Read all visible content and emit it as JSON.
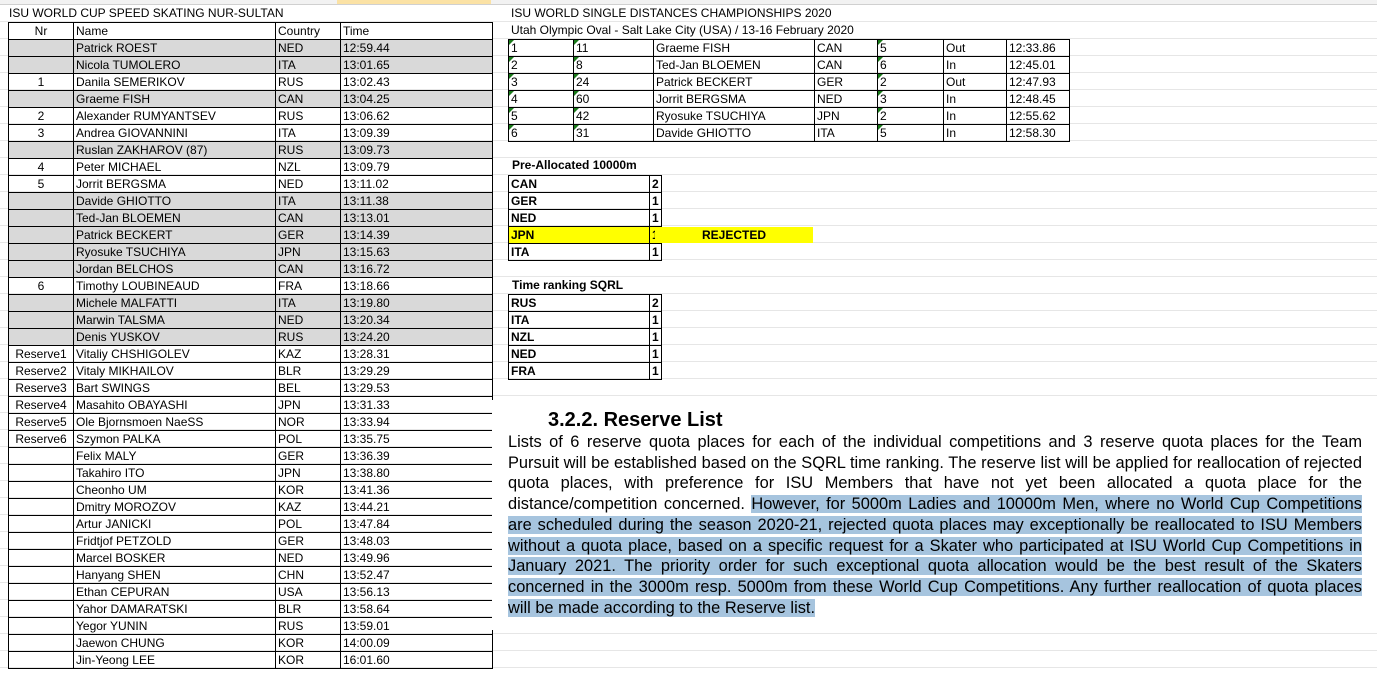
{
  "left_sheet": {
    "title": "ISU WORLD CUP SPEED SKATING NUR-SULTAN",
    "headers": {
      "nr": "Nr",
      "name": "Name",
      "country": "Country",
      "time": "Time"
    },
    "rows": [
      {
        "nr": "",
        "name": "Patrick ROEST",
        "country": "NED",
        "time": "12:59.44",
        "gray": true
      },
      {
        "nr": "",
        "name": "Nicola TUMOLERO",
        "country": "ITA",
        "time": "13:01.65",
        "gray": true
      },
      {
        "nr": "1",
        "name": "Danila SEMERIKOV",
        "country": "RUS",
        "time": "13:02.43",
        "gray": false
      },
      {
        "nr": "",
        "name": "Graeme FISH",
        "country": "CAN",
        "time": "13:04.25",
        "gray": true
      },
      {
        "nr": "2",
        "name": "Alexander RUMYANTSEV",
        "country": "RUS",
        "time": "13:06.62",
        "gray": false
      },
      {
        "nr": "3",
        "name": "Andrea GIOVANNINI",
        "country": "ITA",
        "time": "13:09.39",
        "gray": false
      },
      {
        "nr": "",
        "name": "Ruslan ZAKHAROV (87)",
        "country": "RUS",
        "time": "13:09.73",
        "gray": true
      },
      {
        "nr": "4",
        "name": "Peter MICHAEL",
        "country": "NZL",
        "time": "13:09.79",
        "gray": false
      },
      {
        "nr": "5",
        "name": "Jorrit BERGSMA",
        "country": "NED",
        "time": "13:11.02",
        "gray": false
      },
      {
        "nr": "",
        "name": "Davide GHIOTTO",
        "country": "ITA",
        "time": "13:11.38",
        "gray": true
      },
      {
        "nr": "",
        "name": "Ted-Jan BLOEMEN",
        "country": "CAN",
        "time": "13:13.01",
        "gray": true
      },
      {
        "nr": "",
        "name": "Patrick BECKERT",
        "country": "GER",
        "time": "13:14.39",
        "gray": true
      },
      {
        "nr": "",
        "name": "Ryosuke TSUCHIYA",
        "country": "JPN",
        "time": "13:15.63",
        "gray": true
      },
      {
        "nr": "",
        "name": "Jordan BELCHOS",
        "country": "CAN",
        "time": "13:16.72",
        "gray": true
      },
      {
        "nr": "6",
        "name": "Timothy LOUBINEAUD",
        "country": "FRA",
        "time": "13:18.66",
        "gray": false
      },
      {
        "nr": "",
        "name": "Michele MALFATTI",
        "country": "ITA",
        "time": "13:19.80",
        "gray": true
      },
      {
        "nr": "",
        "name": "Marwin TALSMA",
        "country": "NED",
        "time": "13:20.34",
        "gray": true
      },
      {
        "nr": "",
        "name": "Denis YUSKOV",
        "country": "RUS",
        "time": "13:24.20",
        "gray": true
      },
      {
        "nr": "Reserve1",
        "name": "Vitaliy CHSHIGOLEV",
        "country": "KAZ",
        "time": "13:28.31",
        "gray": false
      },
      {
        "nr": "Reserve2",
        "name": "Vitaly MIKHAILOV",
        "country": "BLR",
        "time": "13:29.29",
        "gray": false
      },
      {
        "nr": "Reserve3",
        "name": "Bart SWINGS",
        "country": "BEL",
        "time": "13:29.53",
        "gray": false
      },
      {
        "nr": "Reserve4",
        "name": "Masahito OBAYASHI",
        "country": "JPN",
        "time": "13:31.33",
        "gray": false
      },
      {
        "nr": "Reserve5",
        "name": "Ole Bjornsmoen NaeSS",
        "country": "NOR",
        "time": "13:33.94",
        "gray": false
      },
      {
        "nr": "Reserve6",
        "name": "Szymon PALKA",
        "country": "POL",
        "time": "13:35.75",
        "gray": false
      },
      {
        "nr": "",
        "name": "Felix MALY",
        "country": "GER",
        "time": "13:36.39",
        "gray": false
      },
      {
        "nr": "",
        "name": "Takahiro ITO",
        "country": "JPN",
        "time": "13:38.80",
        "gray": false
      },
      {
        "nr": "",
        "name": "Cheonho UM",
        "country": "KOR",
        "time": "13:41.36",
        "gray": false
      },
      {
        "nr": "",
        "name": "Dmitry MOROZOV",
        "country": "KAZ",
        "time": "13:44.21",
        "gray": false
      },
      {
        "nr": "",
        "name": "Artur JANICKI",
        "country": "POL",
        "time": "13:47.84",
        "gray": false
      },
      {
        "nr": "",
        "name": "Fridtjof PETZOLD",
        "country": "GER",
        "time": "13:48.03",
        "gray": false
      },
      {
        "nr": "",
        "name": "Marcel BOSKER",
        "country": "NED",
        "time": "13:49.96",
        "gray": false
      },
      {
        "nr": "",
        "name": "Hanyang SHEN",
        "country": "CHN",
        "time": "13:52.47",
        "gray": false
      },
      {
        "nr": "",
        "name": "Ethan CEPURAN",
        "country": "USA",
        "time": "13:56.13",
        "gray": false
      },
      {
        "nr": "",
        "name": "Yahor DAMARATSKI",
        "country": "BLR",
        "time": "13:58.64",
        "gray": false
      },
      {
        "nr": "",
        "name": "Yegor YUNIN",
        "country": "RUS",
        "time": "13:59.01",
        "gray": false
      },
      {
        "nr": "",
        "name": "Jaewon CHUNG",
        "country": "KOR",
        "time": "14:00.09",
        "gray": false
      },
      {
        "nr": "",
        "name": "Jin-Yeong LEE",
        "country": "KOR",
        "time": "16:01.60",
        "gray": false
      }
    ]
  },
  "wsd": {
    "title": "ISU WORLD SINGLE DISTANCES CHAMPIONSHIPS 2020",
    "subtitle": "Utah Olympic Oval - Salt Lake City (USA) / 13-16 February 2020",
    "rows": [
      {
        "rank": "1",
        "num": "11",
        "name": "Graeme FISH",
        "country": "CAN",
        "pair": "5",
        "lane": "Out",
        "time": "12:33.86"
      },
      {
        "rank": "2",
        "num": "8",
        "name": "Ted-Jan BLOEMEN",
        "country": "CAN",
        "pair": "6",
        "lane": "In",
        "time": "12:45.01"
      },
      {
        "rank": "3",
        "num": "24",
        "name": "Patrick BECKERT",
        "country": "GER",
        "pair": "2",
        "lane": "Out",
        "time": "12:47.93"
      },
      {
        "rank": "4",
        "num": "60",
        "name": "Jorrit BERGSMA",
        "country": "NED",
        "pair": "3",
        "lane": "In",
        "time": "12:48.45"
      },
      {
        "rank": "5",
        "num": "42",
        "name": "Ryosuke TSUCHIYA",
        "country": "JPN",
        "pair": "2",
        "lane": "In",
        "time": "12:55.62"
      },
      {
        "rank": "6",
        "num": "31",
        "name": "Davide GHIOTTO",
        "country": "ITA",
        "pair": "5",
        "lane": "In",
        "time": "12:58.30"
      }
    ]
  },
  "preallocated": {
    "title": "Pre-Allocated 10000m",
    "rows": [
      {
        "country": "CAN",
        "value": "2"
      },
      {
        "country": "GER",
        "value": "1"
      },
      {
        "country": "NED",
        "value": "1"
      },
      {
        "country": "JPN",
        "value": "1"
      },
      {
        "country": "ITA",
        "value": "1"
      }
    ],
    "rejected_label": "REJECTED"
  },
  "time_ranking": {
    "title": "Time ranking SQRL",
    "rows": [
      {
        "country": "RUS",
        "value": "2"
      },
      {
        "country": "ITA",
        "value": "1"
      },
      {
        "country": "NZL",
        "value": "1"
      },
      {
        "country": "NED",
        "value": "1"
      },
      {
        "country": "FRA",
        "value": "1"
      }
    ]
  },
  "document": {
    "heading": "3.2.2.  Reserve List",
    "para_plain": "Lists of 6 reserve quota places for each of the individual competitions and 3 reserve quota places for the Team Pursuit will be established based on the SQRL time ranking. The reserve list will be applied for reallocation of rejected quota places, with preference for ISU Members that have not yet been allocated a quota place for the distance/competition concerned.",
    "para_highlight": "However, for 5000m Ladies and 10000m Men, where no World Cup Competitions are scheduled during the season 2020-21, rejected quota places may exceptionally be reallocated to ISU Members without a quota place, based on a specific request for a Skater who participated at ISU World Cup Competitions in January 2021. The priority order for such exceptional quota allocation would be the best result of the Skaters concerned in the 3000m resp. 5000m from these World Cup Competitions. Any further reallocation of quota places will be made according to the Reserve list."
  },
  "colors": {
    "gray_fill": "#d9d9d9",
    "yellow": "#ffff00",
    "highlight": "#a6c4de",
    "triangle": "#1a7a1a"
  }
}
